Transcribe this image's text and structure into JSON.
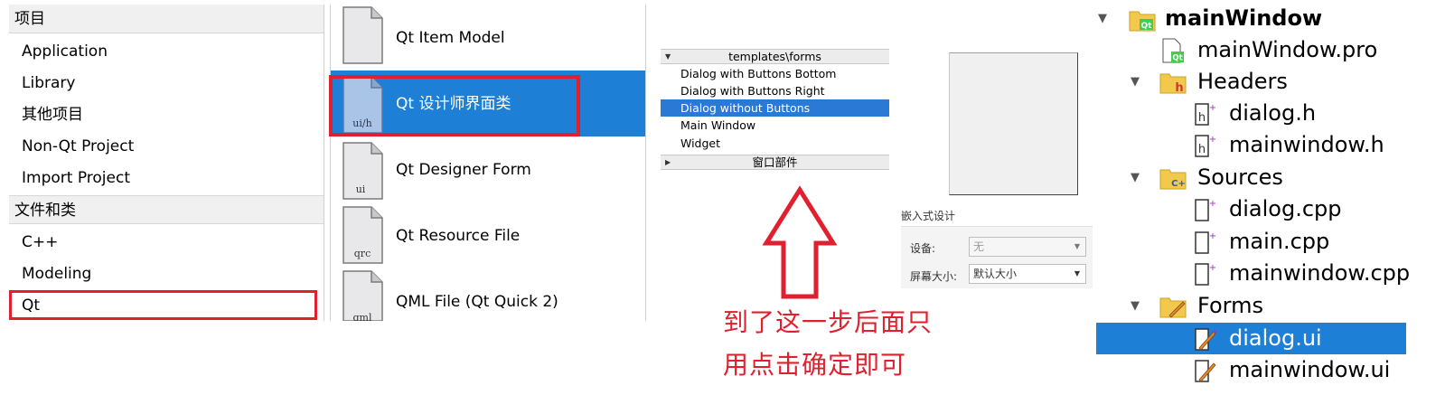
{
  "categories": {
    "header_project": "项目",
    "project_items": [
      "Application",
      "Library",
      "其他项目",
      "Non-Qt Project",
      "Import Project"
    ],
    "header_files": "文件和类",
    "file_items": [
      "C++",
      "Modeling",
      "Qt"
    ]
  },
  "filetypes": [
    {
      "label": "Qt Item Model",
      "icon_text": ""
    },
    {
      "label": "Qt 设计师界面类",
      "icon_text": "ui/h"
    },
    {
      "label": "Qt Designer Form",
      "icon_text": "ui"
    },
    {
      "label": "Qt Resource File",
      "icon_text": "qrc"
    },
    {
      "label": "QML File (Qt Quick 2)",
      "icon_text": "qml"
    }
  ],
  "templates": {
    "header": "templates\\forms",
    "items": [
      "Dialog with Buttons Bottom",
      "Dialog with Buttons Right",
      "Dialog without Buttons",
      "Main Window",
      "Widget"
    ],
    "footer": "窗口部件"
  },
  "embedded": {
    "title": "嵌入式设计",
    "device_label": "设备:",
    "device_value": "无",
    "screen_label": "屏幕大小:",
    "screen_value": "默认大小"
  },
  "annotation": {
    "line1": "到了这一步后面只",
    "line2": "用点击确定即可"
  },
  "project_tree": {
    "root": "mainWindow",
    "pro": "mainWindow.pro",
    "headers": "Headers",
    "header_files": [
      "dialog.h",
      "mainwindow.h"
    ],
    "sources": "Sources",
    "source_files": [
      "dialog.cpp",
      "main.cpp",
      "mainwindow.cpp"
    ],
    "forms": "Forms",
    "form_files": [
      "dialog.ui",
      "mainwindow.ui"
    ]
  },
  "colors": {
    "selection": "#1e7fd6",
    "highlight_box": "#e0202e",
    "annotation": "#e0202e"
  }
}
